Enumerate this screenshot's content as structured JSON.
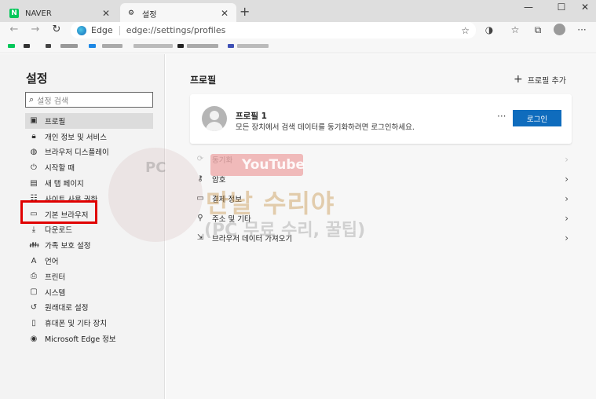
{
  "tabs": [
    {
      "title": "NAVER",
      "favicon": "N"
    },
    {
      "title": "설정"
    }
  ],
  "address": {
    "label": "Edge",
    "url": "edge://settings/profiles"
  },
  "sidebar": {
    "title": "설정",
    "search_placeholder": "설정 검색",
    "items": [
      {
        "label": "프로필",
        "icon": "profile-icon"
      },
      {
        "label": "개인 정보 및 서비스",
        "icon": "lock-icon"
      },
      {
        "label": "브라우저 디스플레이",
        "icon": "palette-icon"
      },
      {
        "label": "시작할 때",
        "icon": "power-icon"
      },
      {
        "label": "새 탭 페이지",
        "icon": "newtab-icon"
      },
      {
        "label": "사이트 사용 권한",
        "icon": "permissions-icon"
      },
      {
        "label": "기본 브라우저",
        "icon": "browser-icon"
      },
      {
        "label": "다운로드",
        "icon": "download-icon"
      },
      {
        "label": "가족 보호 설정",
        "icon": "family-icon"
      },
      {
        "label": "언어",
        "icon": "language-icon"
      },
      {
        "label": "프린터",
        "icon": "printer-icon"
      },
      {
        "label": "시스템",
        "icon": "system-icon"
      },
      {
        "label": "원래대로 설정",
        "icon": "reset-icon"
      },
      {
        "label": "휴대폰 및 기타 장치",
        "icon": "phone-icon"
      },
      {
        "label": "Microsoft Edge 정보",
        "icon": "edge-icon"
      }
    ]
  },
  "main": {
    "heading": "프로필",
    "add_profile": "프로필 추가",
    "profile": {
      "name": "프로필 1",
      "description": "모든 장치에서 검색 데이터를 동기화하려면 로그인하세요.",
      "login_label": "로그인",
      "more": "···"
    },
    "rows": [
      {
        "label": "동기화",
        "icon": "sync-icon",
        "disabled": true
      },
      {
        "label": "암호",
        "icon": "key-icon"
      },
      {
        "label": "결제 정보",
        "icon": "card-icon"
      },
      {
        "label": "주소 및 기타",
        "icon": "location-icon"
      },
      {
        "label": "브라우저 데이터 가져오기",
        "icon": "import-icon"
      }
    ]
  },
  "watermark": {
    "pc": "PC",
    "youtube": "YouTube",
    "main": "만날 수리야",
    "sub": "(PC 무료 수리, 꿀팁)"
  },
  "colors": {
    "accent": "#0f6cbd",
    "highlight": "#e00000"
  }
}
